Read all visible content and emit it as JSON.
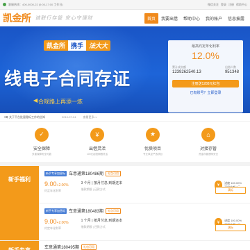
{
  "topbar": {
    "service_label": "客服热线：400-0000-22 (9:00-17:00 工作日)",
    "right_links": [
      "微信关注",
      "登录",
      "注册",
      "帮助中心"
    ]
  },
  "header": {
    "logo": "凯金所",
    "slogan": "诚联行存管 安心守理财",
    "nav": [
      "首页",
      "我要出借",
      "帮助中心",
      "我的账户",
      "信息披露"
    ]
  },
  "banner": {
    "promo_part1": "凯金所",
    "promo_part2": "携手",
    "promo_part3": "法大大",
    "title": "线电子合同存证",
    "subtitle": "合规路上再添一炼",
    "rate_card": {
      "label": "最高约定年化利率",
      "rate": "12.0%",
      "stat1_label": "累计成交额",
      "stat1_value": "1239262540.13",
      "stat2_label": "出借人数",
      "stat2_value": "951348",
      "cta": "注册送1288元红包",
      "sub_link": "已有账号？立即登录"
    }
  },
  "notice": {
    "message": "关于平台批量撤标工作的告知",
    "date": "2019-07-24",
    "more": "查看更多>>"
  },
  "features": [
    {
      "title": "安全保障",
      "desc": "多重保障安全可靠",
      "icon": "shield-icon",
      "glyph": "✓"
    },
    {
      "title": "出借灵活",
      "desc": "100元起投期限灵活",
      "icon": "flexible-icon",
      "glyph": "¥"
    },
    {
      "title": "优质项目",
      "desc": "专业风控严选项目",
      "icon": "quality-icon",
      "glyph": "★"
    },
    {
      "title": "对接存管",
      "desc": "资金存管透明安全",
      "icon": "bank-icon",
      "glyph": "⌂"
    }
  ],
  "sections": [
    {
      "title": "新手福利",
      "items": [
        {
          "tag": "新手专享加息标",
          "name": "车意通第180486期",
          "badge": "礼包可用",
          "rate": "9.00",
          "rate_extra": "+2.00%",
          "rate_label": "约定年化利率",
          "period": "3 个月 | 按月付息,到期还本",
          "period_label": "借款期限 | 还款方式",
          "progress": "进度 100.00%",
          "remaining": "可投金额 0元",
          "button": "满标"
        },
        {
          "tag": "新手专享加息标",
          "name": "车意通第180483期",
          "badge": "礼包可用",
          "rate": "9.00",
          "rate_extra": "+2.00%",
          "rate_label": "约定年化利率",
          "period": "1 个月 | 按月付息,到期还本",
          "period_label": "借款期限 | 还款方式",
          "progress": "进度 100.00%",
          "remaining": "可投金额 0元",
          "button": "满标"
        }
      ]
    }
  ],
  "section2": {
    "title": "新手专享",
    "item_name": "车意通第180495期",
    "badge": "礼包可用"
  }
}
